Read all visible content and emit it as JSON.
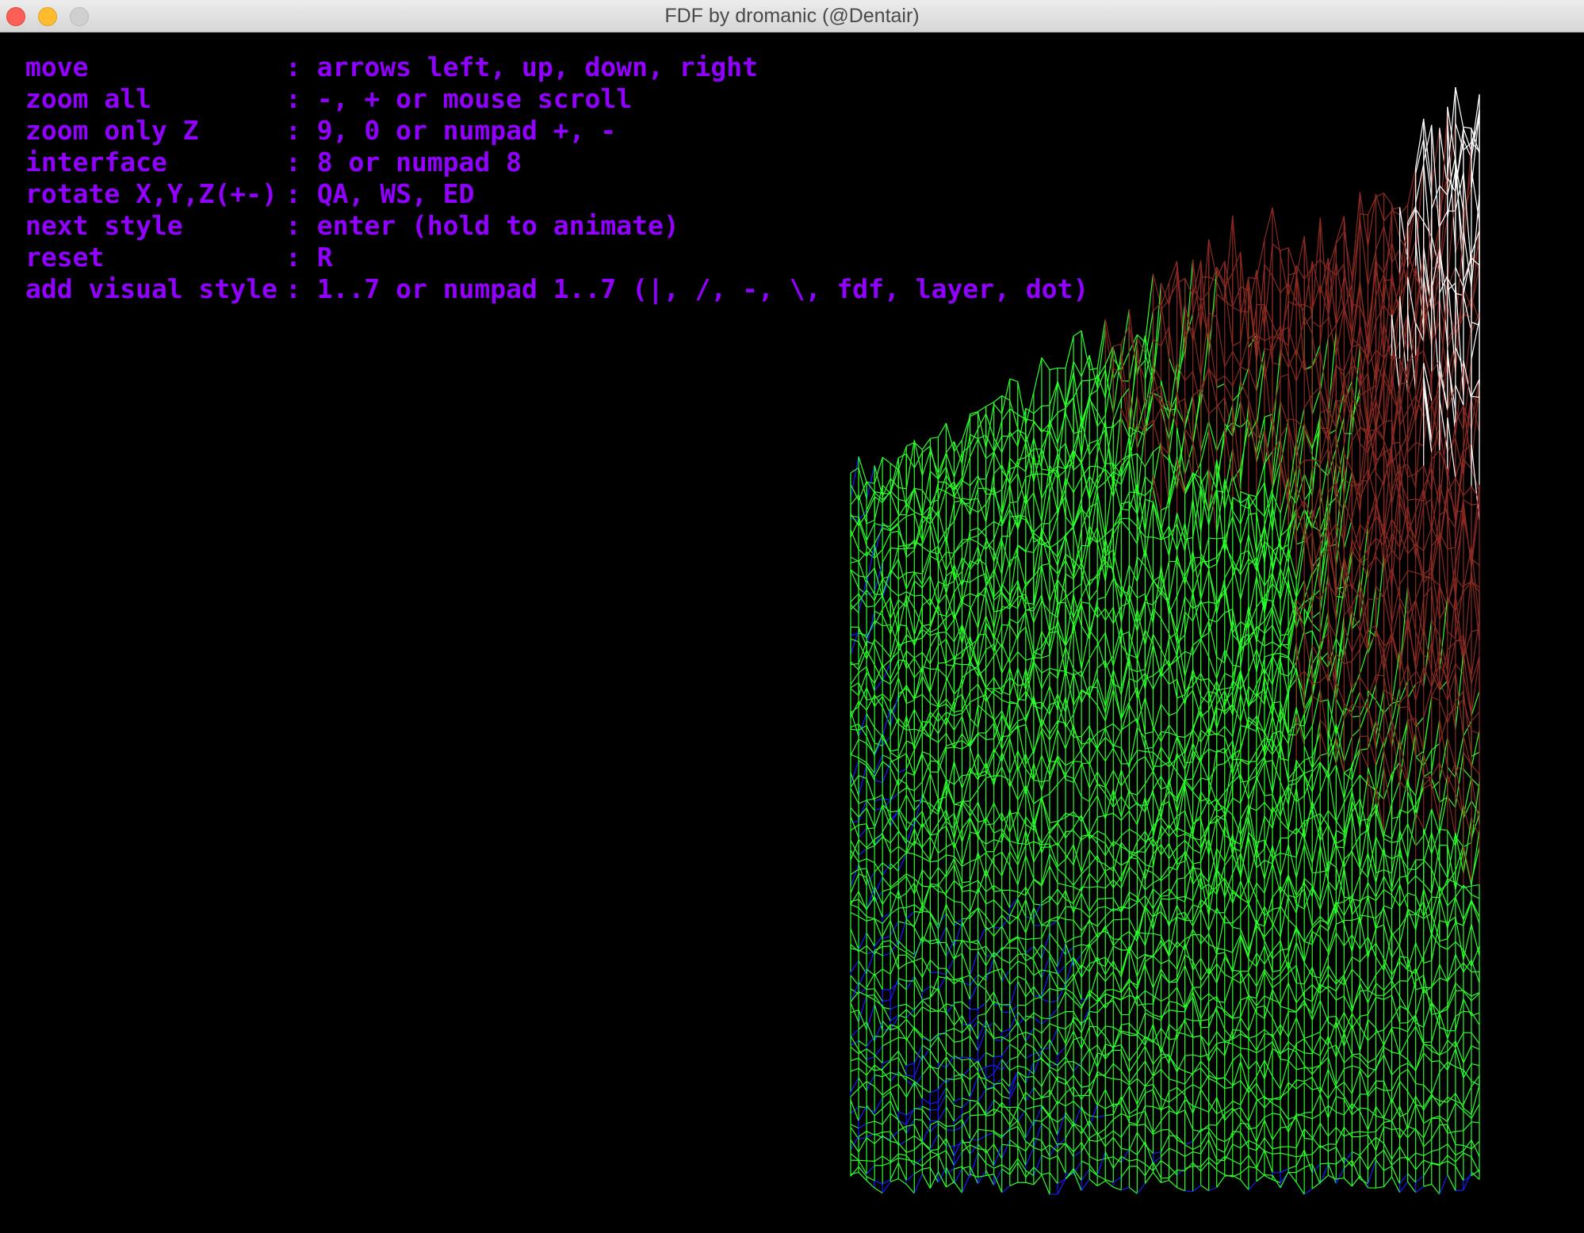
{
  "window": {
    "title": "FDF by dromanic (@Dentair)"
  },
  "help": [
    {
      "key": "move",
      "desc": ": arrows left, up, down, right"
    },
    {
      "key": "zoom all",
      "desc": ": -, + or mouse scroll"
    },
    {
      "key": "zoom only Z",
      "desc": ": 9, 0 or numpad +, -"
    },
    {
      "key": "interface",
      "desc": ": 8 or numpad 8"
    },
    {
      "key": "rotate X,Y,Z(+-)",
      "desc": ": QA, WS, ED"
    },
    {
      "key": "next style",
      "desc": ": enter (hold to animate)"
    },
    {
      "key": "reset",
      "desc": ": R"
    },
    {
      "key": "add visual style",
      "desc": ": 1..7 or numpad 1..7 (|, /, -, \\, fdf, layer, dot)"
    }
  ],
  "colors": {
    "text": "#9200ff",
    "background": "#000000",
    "water": "#1a1aff",
    "grass": "#2bff2b",
    "rock": "#8b2a22",
    "snow": "#ffffff"
  },
  "icons": {
    "close": "close-button-icon",
    "minimize": "minimize-button-icon",
    "zoom": "zoom-button-icon"
  }
}
